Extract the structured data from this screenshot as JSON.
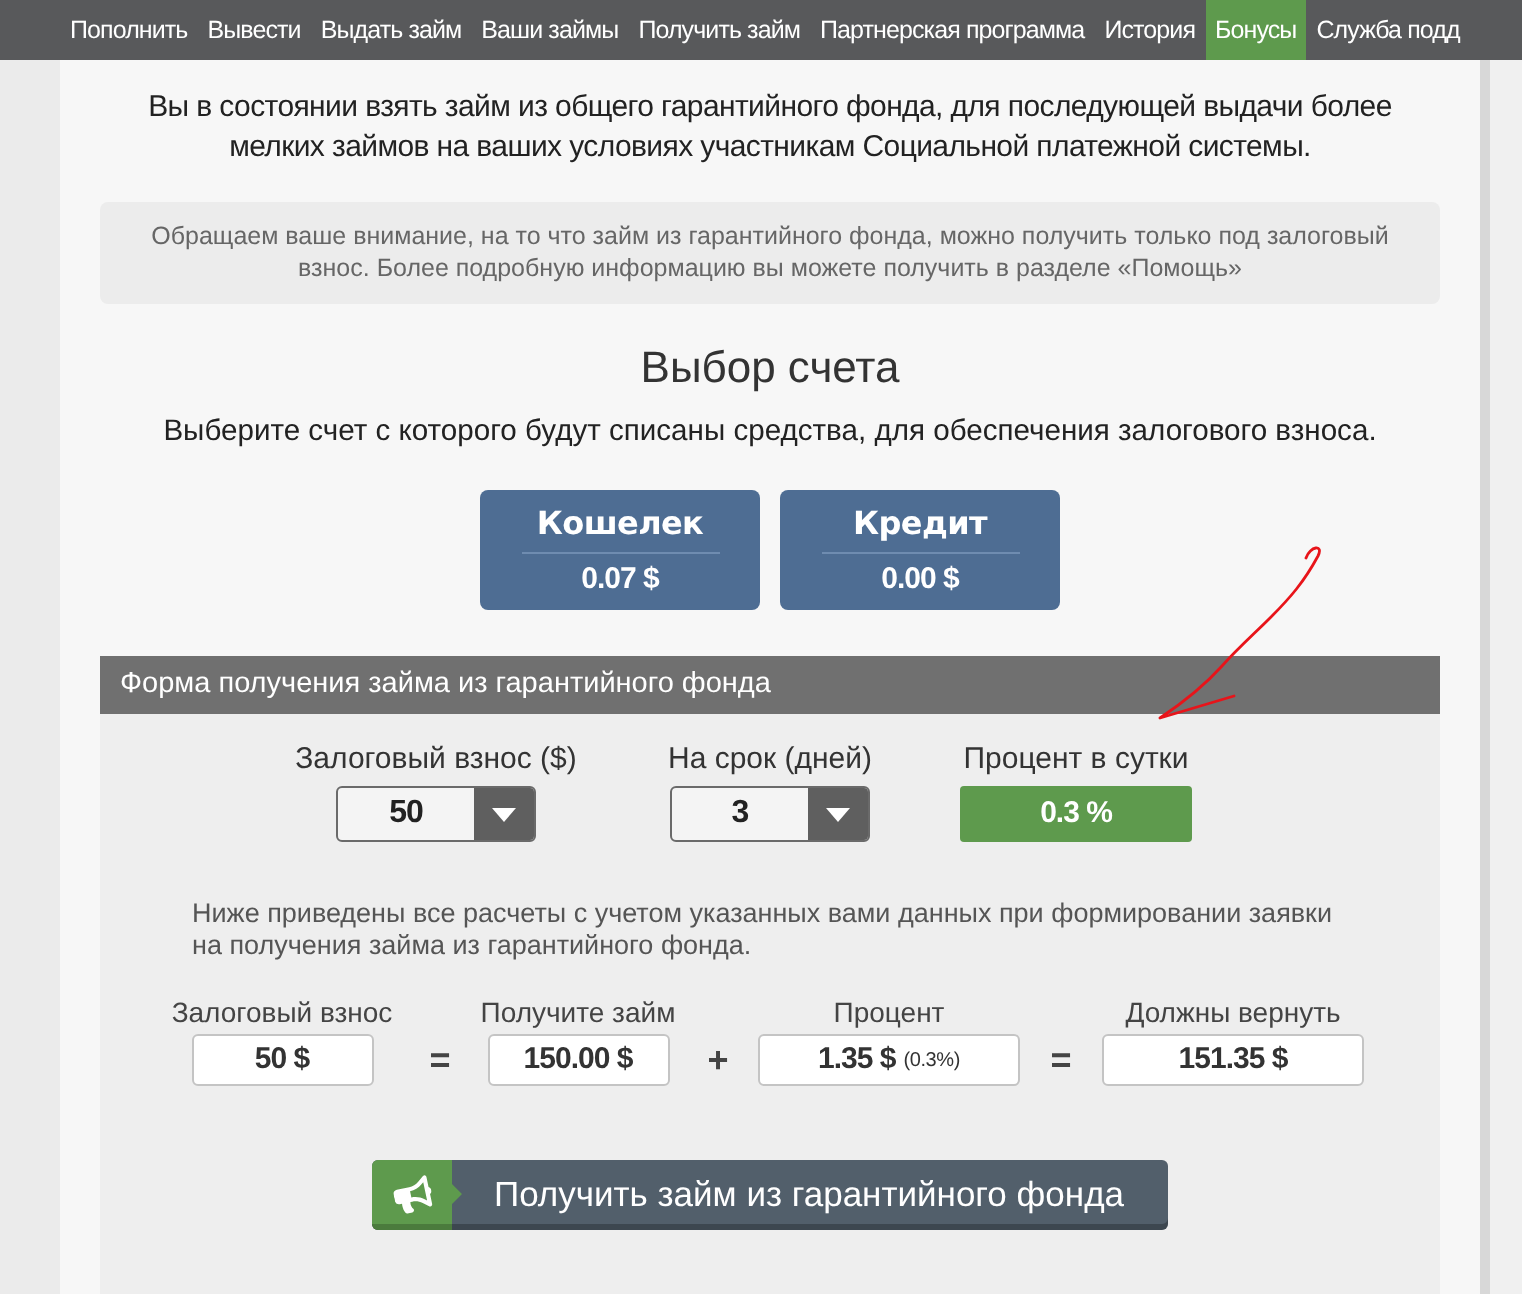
{
  "nav": {
    "items": [
      {
        "label": "Пополнить",
        "selected": false
      },
      {
        "label": "Вывести",
        "selected": false
      },
      {
        "label": "Выдать займ",
        "selected": false
      },
      {
        "label": "Ваши займы",
        "selected": false
      },
      {
        "label": "Получить займ",
        "selected": false
      },
      {
        "label": "Партнерская программа",
        "selected": false
      },
      {
        "label": "История",
        "selected": false
      },
      {
        "label": "Бонусы",
        "selected": true
      },
      {
        "label": "Служба подд",
        "selected": false
      }
    ]
  },
  "intro": "Вы в состоянии взять займ из общего гарантийного фонда, для последующей выдачи более мелких займов на ваших условиях участникам Социальной платежной системы.",
  "notice": "Обращаем ваше внимание, на то что займ из гарантийного фонда, можно получить только под залоговый взнос. Более подробную информацию вы можете получить в разделе «Помощь»",
  "account_choice": {
    "title": "Выбор счета",
    "subtitle": "Выберите счет с которого будут списаны средства, для обеспечения залогового взноса.",
    "accounts": [
      {
        "name": "Кошелек",
        "amount": "0.07 $"
      },
      {
        "name": "Кредит",
        "amount": "0.00 $"
      }
    ]
  },
  "loan_form": {
    "title": "Форма получения займа из гарантийного фонда",
    "selects": [
      {
        "label": "Залоговый взнос ($)",
        "value": "50"
      },
      {
        "label": "На срок (дней)",
        "value": "3"
      }
    ],
    "rate": {
      "label": "Процент в сутки",
      "value": "0.3 %"
    },
    "explanation": "Ниже приведены все расчеты с учетом указанных вами данных при формировании заявки на получения займа из гарантийного фонда.",
    "calculation": [
      {
        "kind": "field",
        "label": "Залоговый взнос",
        "value": "50 $"
      },
      {
        "kind": "operator",
        "symbol": "="
      },
      {
        "kind": "field",
        "label": "Получите займ",
        "value": "150.00 $"
      },
      {
        "kind": "operator",
        "symbol": "+"
      },
      {
        "kind": "field",
        "label": "Процент",
        "value": "1.35 $",
        "note": "(0.3%)"
      },
      {
        "kind": "operator",
        "symbol": "="
      },
      {
        "kind": "field",
        "label": "Должны вернуть",
        "value": "151.35 $"
      }
    ],
    "submit_button": "Получить займ из гарантийного фонда"
  }
}
